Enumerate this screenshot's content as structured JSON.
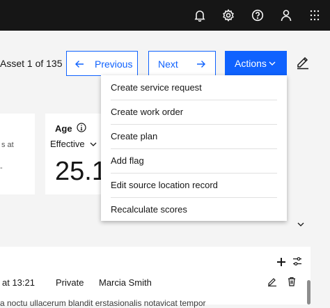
{
  "header": {
    "icons": [
      "bell-icon",
      "gear-icon",
      "help-icon",
      "user-icon",
      "app-switcher-icon"
    ]
  },
  "nav": {
    "asset_count": "Asset 1 of 135",
    "previous_label": "Previous",
    "next_label": "Next",
    "actions_label": "Actions"
  },
  "actions_menu": {
    "items": [
      "Create service request",
      "Create work order",
      "Create plan",
      "Add flag",
      "Edit source location record",
      "Recalculate scores"
    ]
  },
  "cards": {
    "left_partial_text": "s at",
    "left_partial_dash": "-",
    "age": {
      "title": "Age",
      "selector": "Effective",
      "value": "25.1"
    }
  },
  "table": {
    "row": {
      "time": "at 13:21",
      "visibility": "Private",
      "author": "Marcia Smith"
    },
    "cut_text": "a noctu ullacerum blandit erstasionalis notavicat tempor"
  },
  "colors": {
    "header_bg": "#161616",
    "primary": "#0f62fe",
    "page_bg": "#f4f4f4"
  }
}
